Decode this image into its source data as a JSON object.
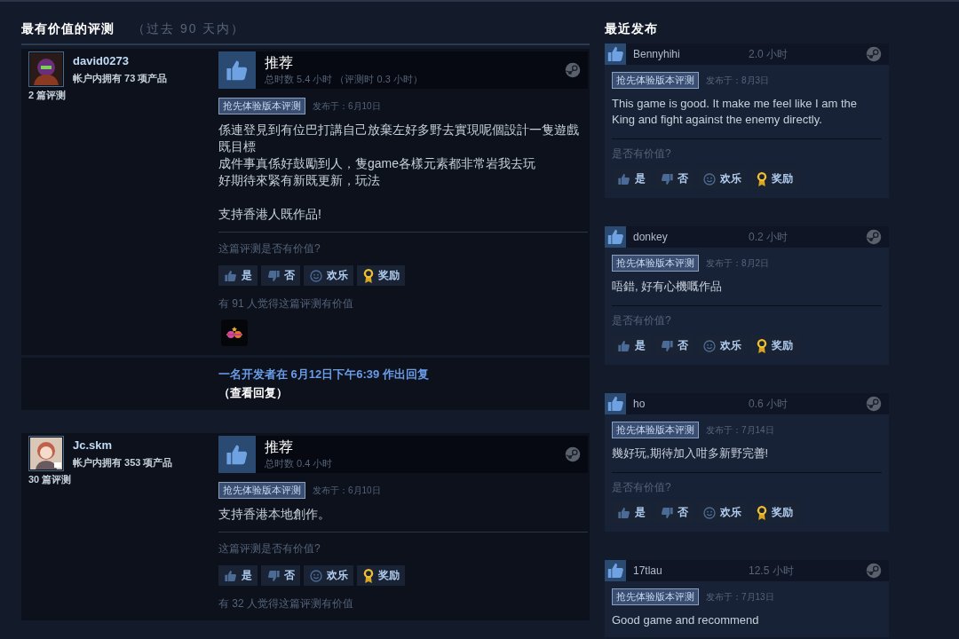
{
  "most_helpful": {
    "title": "最有价值的评测",
    "subtitle": "（过去 90 天内）",
    "reviews": [
      {
        "user": "david0273",
        "products": "帐户内拥有 73 项产品",
        "review_count": "2 篇评测",
        "verdict": "推荐",
        "playtime": "总时数 5.4 小时 （评测时 0.3 小时）",
        "tag": "抢先体验版本评测",
        "posted": "发布于：6月10日",
        "body": [
          {
            "lines": [
              "係連登見到有位巴打講自己放棄左好多野去實現呢個設計一隻遊戲既目標",
              "成件事真係好鼓勵到人，隻game各樣元素都非常岩我去玩",
              "好期待來緊有新既更新，玩法"
            ]
          },
          {
            "lines": [
              "支持香港人既作品!"
            ]
          }
        ],
        "question": "这篇评测是否有价值?",
        "buttons": [
          {
            "kind": "yes",
            "label": "是"
          },
          {
            "kind": "no",
            "label": "否"
          },
          {
            "kind": "funny",
            "label": "欢乐"
          },
          {
            "kind": "award",
            "label": "奖励"
          }
        ],
        "helpful": "有 91 人觉得这篇评测有价值",
        "has_award": true,
        "developer_reply": {
          "text": "一名开发者在 6月12日下午6:39 作出回复",
          "link": "（查看回复）"
        }
      },
      {
        "user": "Jc.skm",
        "products": "帐户内拥有 353 项产品",
        "review_count": "30 篇评测",
        "verdict": "推荐",
        "playtime": "总时数 0.4 小时",
        "tag": "抢先体验版本评测",
        "posted": "发布于：6月10日",
        "body": [
          {
            "lines": [
              "支持香港本地創作。"
            ]
          }
        ],
        "question": "这篇评测是否有价值?",
        "buttons": [
          {
            "kind": "yes",
            "label": "是"
          },
          {
            "kind": "no",
            "label": "否"
          },
          {
            "kind": "funny",
            "label": "欢乐"
          },
          {
            "kind": "award",
            "label": "奖励"
          }
        ],
        "helpful": "有 32 人觉得这篇评测有价值",
        "has_award": false
      }
    ]
  },
  "recent": {
    "title": "最近发布",
    "reviews": [
      {
        "user": "Bennyhihi",
        "hours": "2.0 小时",
        "tag": "抢先体验版本评测",
        "posted": "发布于：8月3日",
        "body": "This game is good. It make me feel like I am the King and fight against the enemy directly.",
        "question": "是否有价值?",
        "buttons": [
          {
            "kind": "yes",
            "label": "是"
          },
          {
            "kind": "no",
            "label": "否"
          },
          {
            "kind": "funny",
            "label": "欢乐"
          },
          {
            "kind": "award",
            "label": "奖励"
          }
        ]
      },
      {
        "user": "donkey",
        "hours": "0.2 小时",
        "tag": "抢先体验版本评测",
        "posted": "发布于：8月2日",
        "body": "唔錯, 好有心機嘅作品",
        "question": "是否有价值?",
        "buttons": [
          {
            "kind": "yes",
            "label": "是"
          },
          {
            "kind": "no",
            "label": "否"
          },
          {
            "kind": "funny",
            "label": "欢乐"
          },
          {
            "kind": "award",
            "label": "奖励"
          }
        ]
      },
      {
        "user": "ho",
        "hours": "0.6 小时",
        "tag": "抢先体验版本评测",
        "posted": "发布于：7月14日",
        "body": "幾好玩,期待加入咁多新野完善!",
        "question": "是否有价值?",
        "buttons": [
          {
            "kind": "yes",
            "label": "是"
          },
          {
            "kind": "no",
            "label": "否"
          },
          {
            "kind": "funny",
            "label": "欢乐"
          },
          {
            "kind": "award",
            "label": "奖励"
          }
        ]
      },
      {
        "user": "17tlau",
        "hours": "12.5 小时",
        "tag": "抢先体验版本评测",
        "posted": "发布于：7月13日",
        "body": "Good game and recommend"
      }
    ]
  }
}
